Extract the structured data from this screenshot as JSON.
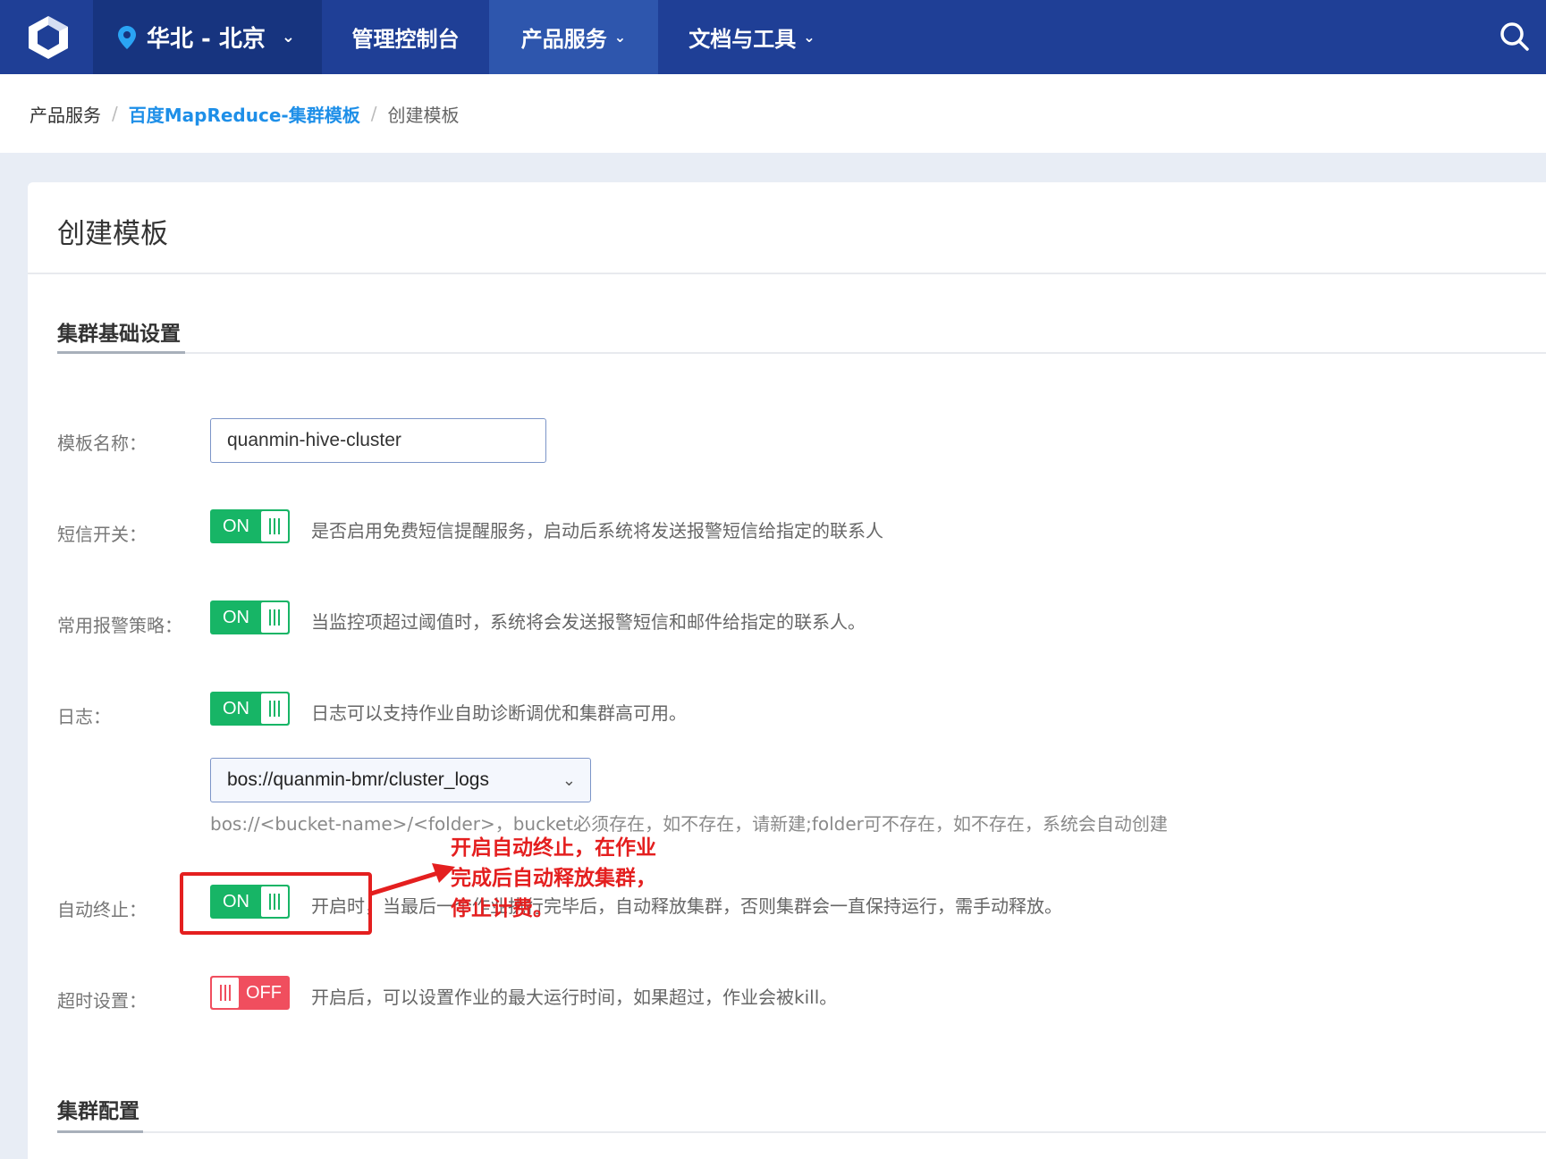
{
  "topbar": {
    "region": "华北 - 北京",
    "nav": {
      "console": "管理控制台",
      "products": "产品服务",
      "docs": "文档与工具"
    }
  },
  "breadcrumb": {
    "root": "产品服务",
    "parent": "百度MapReduce-集群模板",
    "current": "创建模板"
  },
  "card": {
    "title": "创建模板",
    "section_basic": "集群基础设置",
    "section_config": "集群配置"
  },
  "form": {
    "template_name_label": "模板名称：",
    "template_name_value": "quanmin-hive-cluster",
    "sms_label": "短信开关：",
    "sms_state": "ON",
    "sms_desc": "是否启用免费短信提醒服务，启动后系统将发送报警短信给指定的联系人",
    "alarm_label": "常用报警策略：",
    "alarm_state": "ON",
    "alarm_desc": "当监控项超过阈值时，系统将会发送报警短信和邮件给指定的联系人。",
    "log_label": "日志：",
    "log_state": "ON",
    "log_desc": "日志可以支持作业自助诊断调优和集群高可用。",
    "log_path": "bos://quanmin-bmr/cluster_logs",
    "log_hint": "bos://<bucket-name>/<folder>，bucket必须存在，如不存在，请新建;folder可不存在，如不存在，系统会自动创建",
    "autoterm_label": "自动终止：",
    "autoterm_state": "ON",
    "autoterm_desc": "开启时，当最后一个作业执行完毕后，自动释放集群，否则集群会一直保持运行，需手动释放。",
    "timeout_label": "超时设置：",
    "timeout_state": "OFF",
    "timeout_desc": "开启后，可以设置作业的最大运行时间，如果超过，作业会被kill。"
  },
  "annotation": {
    "line1": "开启自动终止，在作业",
    "line2": "完成后自动释放集群，",
    "line3": "停止计费。"
  },
  "colors": {
    "topbar": "#1f3f96",
    "on": "#17b566",
    "off": "#f04e5e",
    "annotation": "#e41f1f",
    "link": "#1e8fe8"
  }
}
